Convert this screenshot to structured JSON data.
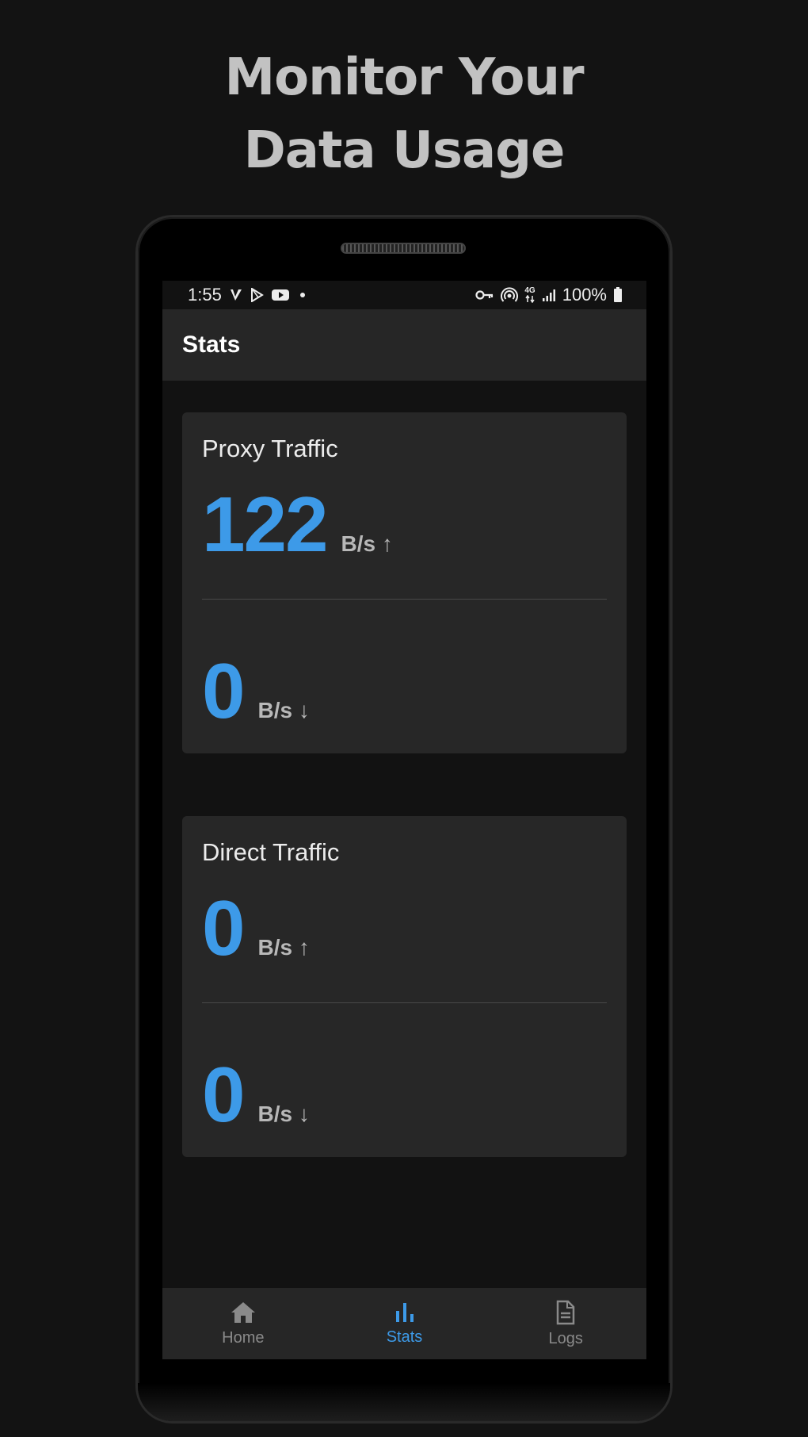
{
  "promo": {
    "line1": "Monitor Your",
    "line2": "Data Usage"
  },
  "status_bar": {
    "time": "1:55",
    "battery": "100%",
    "network": "4G",
    "icons": [
      "vpn-v-icon",
      "play-store-icon",
      "youtube-icon",
      "notification-dot-icon",
      "vpn-key-icon",
      "hotspot-icon",
      "network-4g-icon",
      "signal-icon",
      "battery-icon"
    ]
  },
  "app_bar": {
    "title": "Stats"
  },
  "proxy_card": {
    "title": "Proxy Traffic",
    "upload_value": "122",
    "upload_unit": "B/s ↑",
    "download_value": "0",
    "download_unit": "B/s ↓"
  },
  "direct_card": {
    "title": "Direct Traffic",
    "upload_value": "0",
    "upload_unit": "B/s ↑",
    "download_value": "0",
    "download_unit": "B/s ↓"
  },
  "bottom_nav": {
    "items": [
      {
        "label": "Home",
        "icon": "home-icon",
        "active": false
      },
      {
        "label": "Stats",
        "icon": "bar-chart-icon",
        "active": true
      },
      {
        "label": "Logs",
        "icon": "document-icon",
        "active": false
      }
    ]
  },
  "colors": {
    "accent": "#3d9ae8",
    "background": "#121212",
    "surface": "#272727",
    "inactive": "#8a8a8a"
  }
}
